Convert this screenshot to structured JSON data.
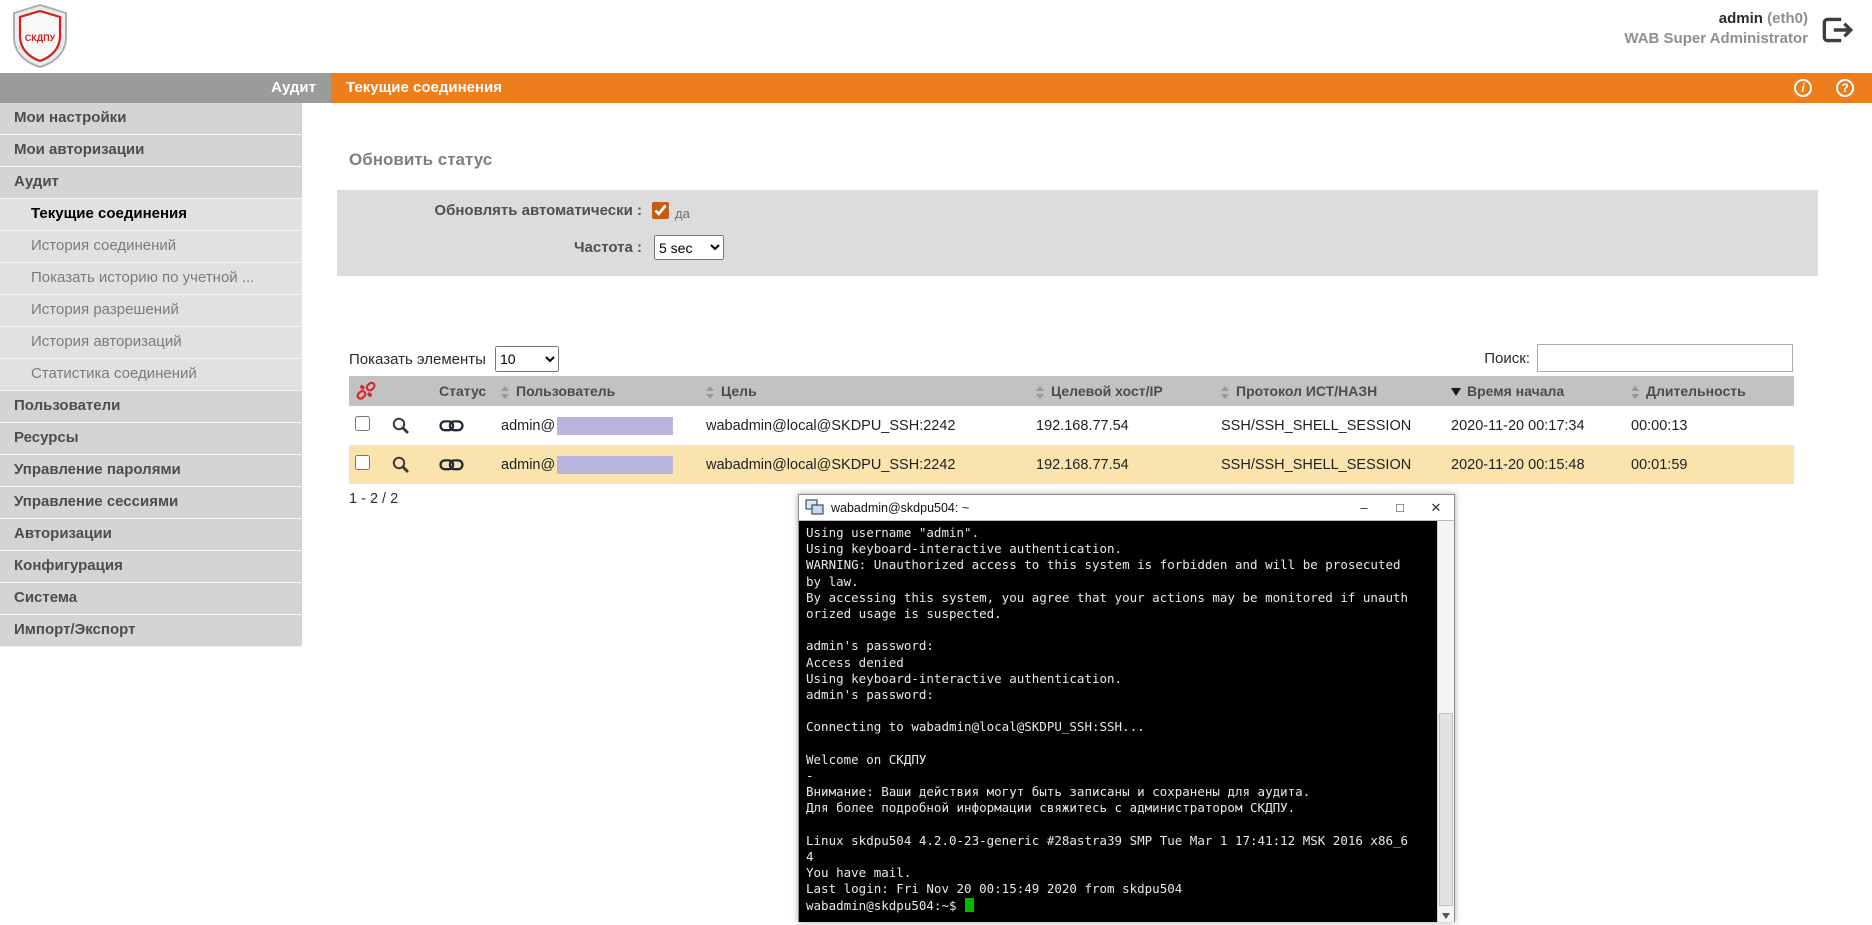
{
  "header": {
    "username": "admin",
    "interface": "(eth0)",
    "role": "WAB Super Administrator",
    "logo_text": "СКДПУ"
  },
  "topbar": {
    "section": "Аудит",
    "page": "Текущие соединения",
    "info_glyph": "i",
    "help_glyph": "?"
  },
  "sidebar": {
    "items": [
      {
        "label": "Мои настройки"
      },
      {
        "label": "Мои авторизации"
      },
      {
        "label": "Аудит"
      },
      {
        "label": "Текущие соединения"
      },
      {
        "label": "История соединений"
      },
      {
        "label": "Показать историю по учетной ..."
      },
      {
        "label": "История разрешений"
      },
      {
        "label": "История авторизаций"
      },
      {
        "label": "Статистика соединений"
      },
      {
        "label": "Пользователи"
      },
      {
        "label": "Ресурсы"
      },
      {
        "label": "Управление паролями"
      },
      {
        "label": "Управление сессиями"
      },
      {
        "label": "Авторизации"
      },
      {
        "label": "Конфигурация"
      },
      {
        "label": "Система"
      },
      {
        "label": "Импорт/Экспорт"
      }
    ]
  },
  "main": {
    "title": "Обновить статус",
    "refresh": {
      "auto_label": "Обновлять автоматически :",
      "auto_value": "да",
      "freq_label": "Частота :",
      "freq_value": "5 sec"
    },
    "list_controls": {
      "show_label": "Показать элементы",
      "show_value": "10",
      "search_label": "Поиск:"
    },
    "table": {
      "columns": [
        "Статус",
        "Пользователь",
        "Цель",
        "Целевой хост/IP",
        "Протокол ИСТ/НАЗН",
        "Время начала",
        "Длительность"
      ],
      "rows": [
        {
          "user_prefix": "admin@",
          "target": "wabadmin@local@SKDPU_SSH:2242",
          "host": "192.168.77.54",
          "protocol": "SSH/SSH_SHELL_SESSION",
          "start": "2020-11-20 00:17:34",
          "duration": "00:00:13"
        },
        {
          "user_prefix": "admin@",
          "target": "wabadmin@local@SKDPU_SSH:2242",
          "host": "192.168.77.54",
          "protocol": "SSH/SSH_SHELL_SESSION",
          "start": "2020-11-20 00:15:48",
          "duration": "00:01:59"
        }
      ],
      "pagination": "1 - 2 / 2"
    }
  },
  "terminal": {
    "title": "wabadmin@skdpu504: ~",
    "minimize": "–",
    "maximize": "□",
    "close": "✕",
    "body": "Using username \"admin\".\nUsing keyboard-interactive authentication.\nWARNING: Unauthorized access to this system is forbidden and will be prosecuted\nby law.\nBy accessing this system, you agree that your actions may be monitored if unauth\norized usage is suspected.\n\nadmin's password:\nAccess denied\nUsing keyboard-interactive authentication.\nadmin's password:\n\nConnecting to wabadmin@local@SKDPU_SSH:SSH...\n\nWelcome on СКДПУ\n-\nВнимание: Ваши действия могут быть записаны и сохранены для аудита.\nДля более подробной информации свяжитесь с администратором СКДПУ.\n\nLinux skdpu504 4.2.0-23-generic #28astra39 SMP Tue Mar 1 17:41:12 MSK 2016 x86_6\n4\nYou have mail.\nLast login: Fri Nov 20 00:15:49 2020 from skdpu504",
    "prompt": "wabadmin@skdpu504:~$"
  },
  "colors": {
    "accent_orange": "#ee7d1c",
    "topbar_gray": "#9b9b9b",
    "row_highlight": "#fbe3ae",
    "redacted_mask": "#b9b5de",
    "terminal_cursor_green": "#00b800",
    "broken_link_red": "#d42a2a"
  }
}
